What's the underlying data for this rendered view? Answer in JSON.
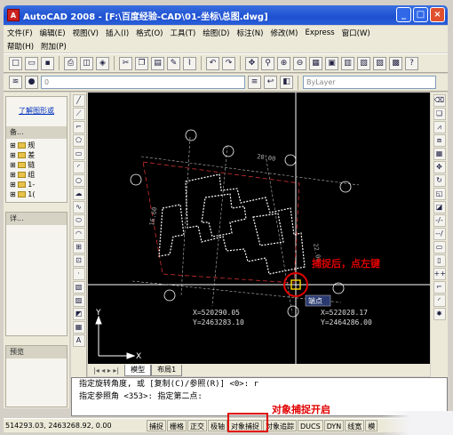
{
  "titlebar": {
    "title": "AutoCAD 2008 - [F:\\百度经验-CAD\\01-坐标\\总图.dwg]",
    "app_icon": "A"
  },
  "menu": {
    "row1": [
      "文件(F)",
      "编辑(E)",
      "视图(V)",
      "插入(I)",
      "格式(O)",
      "工具(T)",
      "绘图(D)",
      "标注(N)",
      "修改(M)",
      "Express",
      "窗口(W)"
    ],
    "row2": [
      "帮助(H)",
      "附加(P)"
    ]
  },
  "layer_combo": {
    "value": "0"
  },
  "bylayer_combo": {
    "value": "ByLayer"
  },
  "leftpanel": {
    "link": "了解图形或",
    "pane1_head": "备...",
    "tree": [
      "规",
      "差",
      "链",
      "组",
      "1-",
      "1("
    ],
    "pane2_head": "详...",
    "pane3_head": "预览"
  },
  "canvas": {
    "snap_label": "端点",
    "annotation_red": "捕捉后，点左键",
    "coord_a": "X=520290.05\nY=2463283.10",
    "coord_b": "X=522028.17\nY=2464286.00"
  },
  "tabs": {
    "model": "模型",
    "layout1": "布局1"
  },
  "command": {
    "line1": "指定旋转角度, 或 [复制(C)/参照(R)] <0>:  r",
    "line2": "指定参照角 <353>:  指定第二点:"
  },
  "statusbar": {
    "coords": "514293.03, 2463268.92, 0.00",
    "buttons": [
      "捕捉",
      "栅格",
      "正交",
      "极轴",
      "对象捕捉",
      "对象追踪",
      "DUCS",
      "DYN",
      "线宽",
      "模"
    ]
  },
  "annotation": {
    "osnap_note": "对象捕捉开启"
  },
  "colors": {
    "title_blue": "#1d50d0",
    "canvas_bg": "#000000",
    "highlight_red": "#e00000"
  }
}
